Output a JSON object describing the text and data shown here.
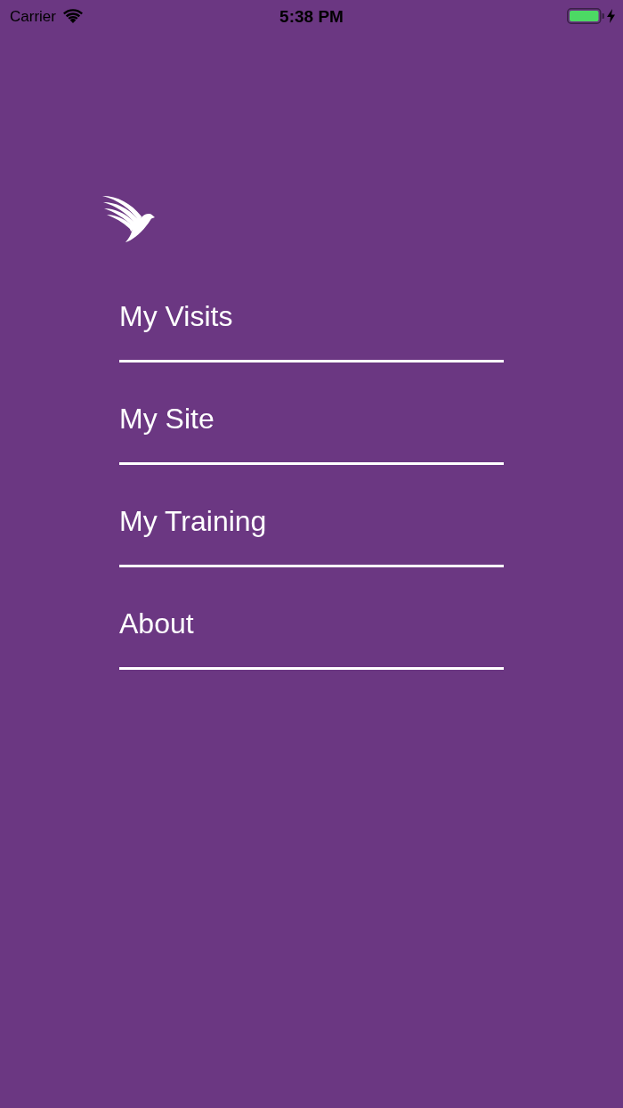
{
  "status_bar": {
    "carrier": "Carrier",
    "time": "5:38 PM"
  },
  "menu": {
    "items": [
      {
        "label": "My Visits"
      },
      {
        "label": "My Site"
      },
      {
        "label": "My Training"
      },
      {
        "label": "About"
      }
    ]
  }
}
